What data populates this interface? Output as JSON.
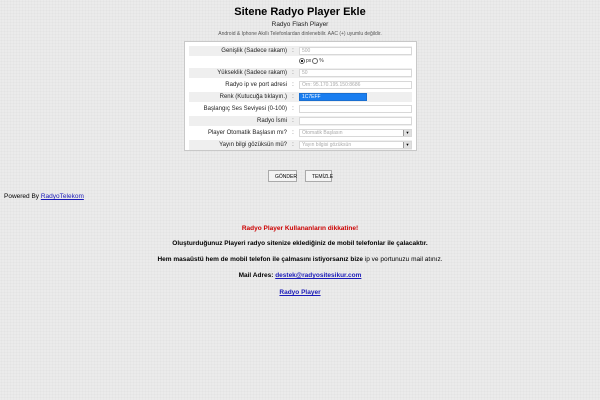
{
  "header": {
    "title": "Sitene Radyo Player Ekle",
    "subtitle": "Radyo Flash Player",
    "notice": "Android & Iphone Akıllı Telefonlardan dinlenebilir. AAC (+) uyumlu değildir."
  },
  "form": {
    "rows": [
      {
        "label": "Genişlik (Sadece rakam)",
        "value": "500",
        "units": [
          "px",
          "%"
        ]
      },
      {
        "label": "Yükseklik (Sadece rakam)",
        "value": "50"
      },
      {
        "label": "Radyo ip ve port adresi",
        "placeholder": "Örn: 95.170.195.150:8686"
      },
      {
        "label": "Renk (Kutucuğa tıklayın.)",
        "value": "1C7EFF"
      },
      {
        "label": "Başlangıç Ses Seviyesi (0-100)",
        "value": ""
      },
      {
        "label": "Radyo İsmi",
        "value": ""
      },
      {
        "label": "Player Otomatik Başlasın mı?",
        "value": "Otomatik Başlasın"
      },
      {
        "label": "Yayın bilgi gözüksün mü?",
        "value": "Yayın bilgisi gözüksün"
      }
    ],
    "separator": ":"
  },
  "buttons": {
    "submit": "GÖNDER",
    "clear": "TEMİZLE"
  },
  "footer": {
    "powered_prefix": "Powered By ",
    "powered_link": "RadyoTelekom"
  },
  "messages": {
    "attention": "Radyo Player Kullananların dikkatine!",
    "line1": "Oluşturduğunuz Playeri radyo sitenize eklediğiniz de mobil telefonlar ile çalacaktır.",
    "line2_bold": "Hem masaüstü hem de mobil telefon ile çalmasını istiyorsanız bize",
    "line2_normal": " ip ve portunuzu mail atınız.",
    "mail_label": "Mail Adres: ",
    "mail_value": "destek@radyositesikur.com",
    "link": "Radyo Player"
  }
}
